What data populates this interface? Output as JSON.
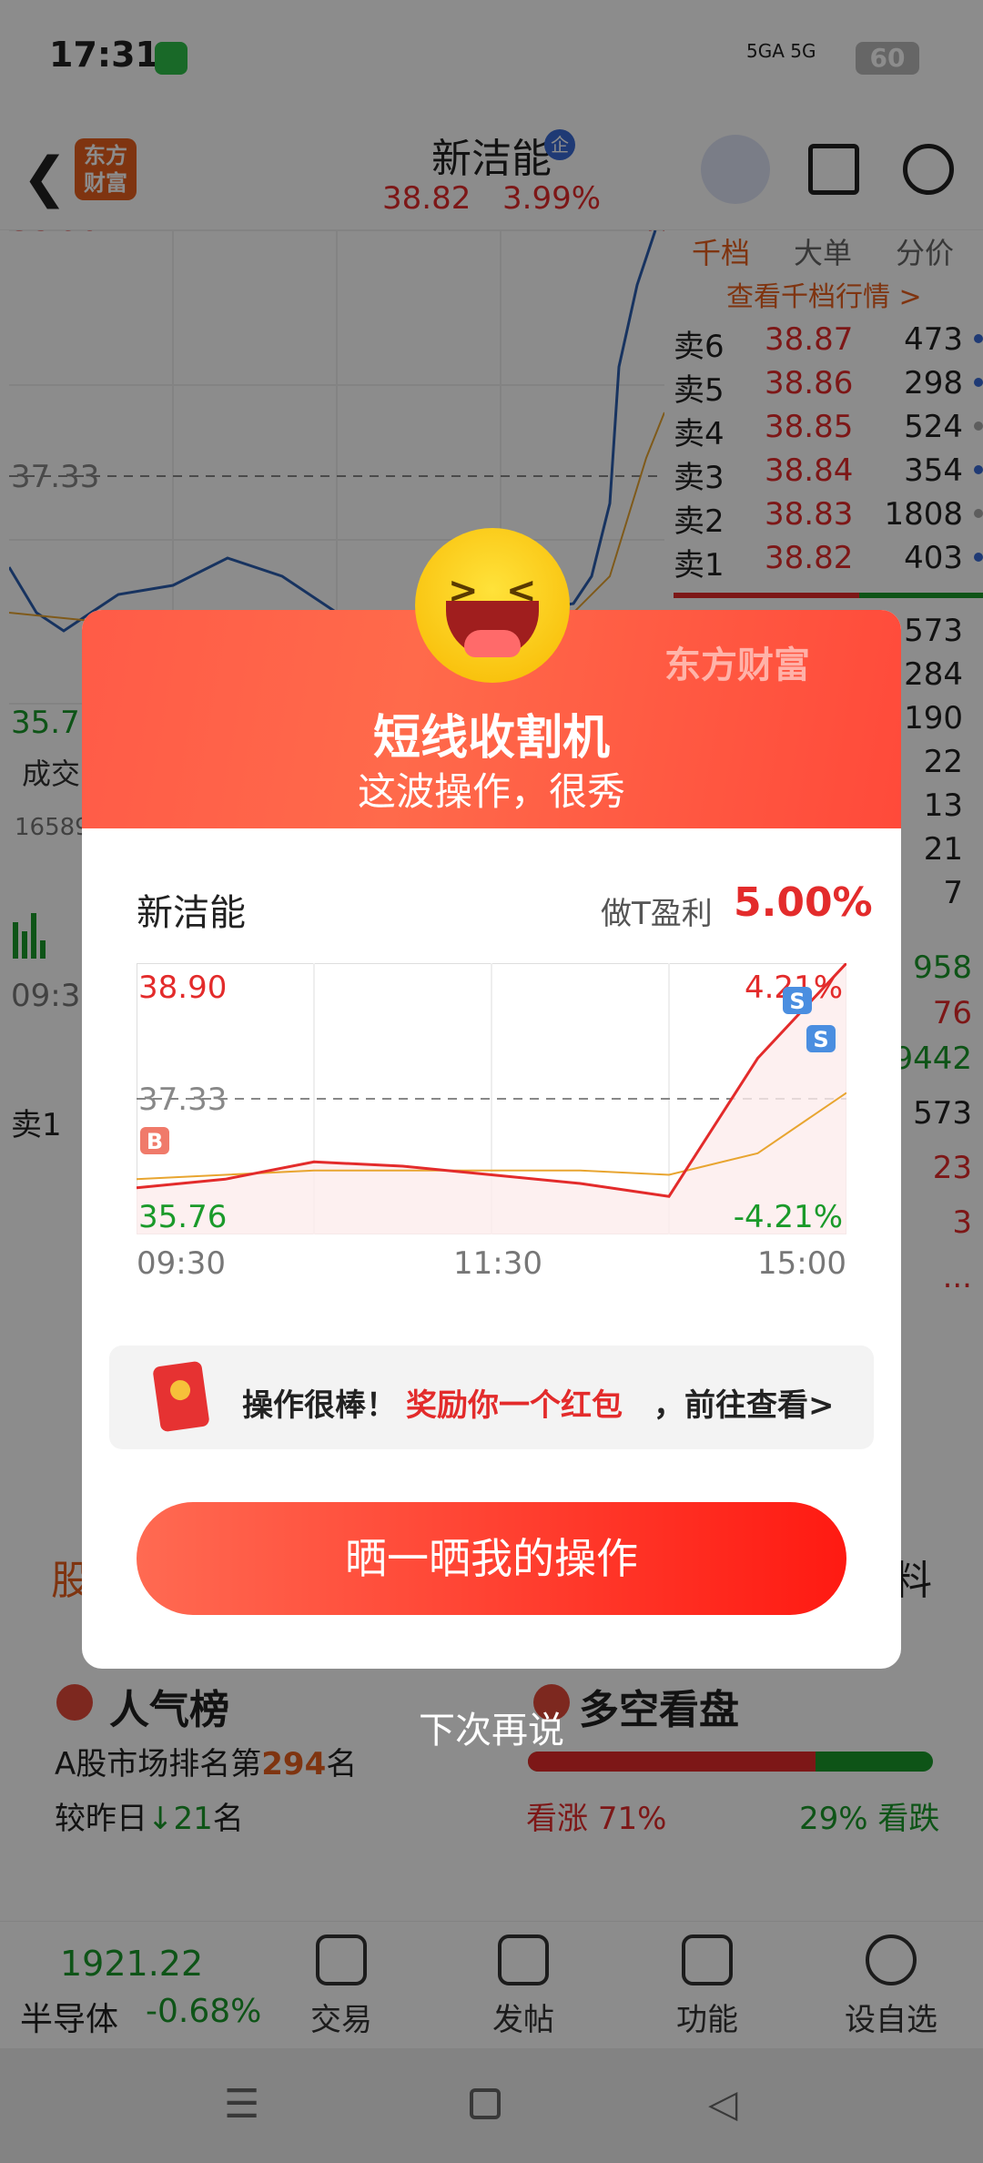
{
  "status_bar": {
    "time": "17:31",
    "signal_label": "5GA 5G",
    "battery": "60"
  },
  "header": {
    "logo_text": "东方财富",
    "stock_name": "新洁能",
    "badge": "企",
    "price": "38.82",
    "change_pct": "3.99%"
  },
  "background": {
    "chart_high": "38.90",
    "chart_ref": "37.33",
    "chart_low": "35.7",
    "chart_high_pct": "4.21%",
    "volume_label": "成交",
    "volume_value": "16589",
    "time_start": "09:30",
    "sell1_label": "卖1",
    "orderbook_tabs": [
      "千档",
      "大单",
      "分价"
    ],
    "orderbook_link": "查看千档行情 >",
    "orderbook_rows": [
      {
        "label": "卖6",
        "price": "38.87",
        "volume": "473"
      },
      {
        "label": "卖5",
        "price": "38.86",
        "volume": "298"
      },
      {
        "label": "卖4",
        "price": "38.85",
        "volume": "524"
      },
      {
        "label": "卖3",
        "price": "38.84",
        "volume": "354"
      },
      {
        "label": "卖2",
        "price": "38.83",
        "volume": "1808"
      },
      {
        "label": "卖1",
        "price": "38.82",
        "volume": "403"
      }
    ],
    "orderbook_more": [
      "573",
      "284",
      "190",
      "22",
      "13",
      "21",
      "7"
    ],
    "side_values": [
      "958",
      "76",
      "9442",
      "573",
      "23",
      "3",
      "..."
    ],
    "tabs_left": "股",
    "tabs_right": "料",
    "popularity": {
      "title": "人气榜",
      "rank_prefix": "A股市场排名第",
      "rank": "294",
      "rank_suffix": "名",
      "change_prefix": "较昨日",
      "change": "21",
      "change_suffix": "名"
    },
    "longshort": {
      "title": "多空看盘",
      "bull_label": "看涨",
      "bull_pct": "71%",
      "bear_pct": "29%",
      "bear_label": "看跌",
      "bull_fraction": 0.71
    },
    "nav": {
      "index_value": "1921.22",
      "index_name": "半导体",
      "index_change": "-0.68%",
      "items": [
        "交易",
        "发帖",
        "功能",
        "设自选"
      ]
    }
  },
  "modal": {
    "brand": "东方财富",
    "title": "短线收割机",
    "subtitle": "这波操作，很秀",
    "stock_name": "新洁能",
    "profit_label": "做T盈利",
    "profit_value": "5.00%",
    "chart": {
      "high": "38.90",
      "ref": "37.33",
      "low": "35.76",
      "high_pct": "4.21%",
      "low_pct": "-4.21%",
      "buy_marker": "B",
      "sell_marker": "S"
    },
    "time_ticks": [
      "09:30",
      "11:30",
      "15:00"
    ],
    "reward_text1": "操作很棒！",
    "reward_text2": "奖励你一个红包",
    "reward_text3": "，前往查看>",
    "share_button": "晒一晒我的操作",
    "later_button": "下次再说"
  },
  "chart_data": {
    "type": "line",
    "title": "",
    "x": [
      "09:30",
      "10:00",
      "10:30",
      "11:00",
      "11:30",
      "13:30",
      "14:00",
      "14:30",
      "15:00"
    ],
    "series": [
      {
        "values": [
          36.3,
          36.4,
          36.6,
          36.55,
          36.45,
          36.35,
          36.2,
          37.8,
          38.9
        ]
      },
      {
        "values": [
          36.4,
          36.45,
          36.5,
          36.5,
          36.5,
          36.5,
          36.45,
          36.7,
          37.4
        ]
      }
    ],
    "ylim": [
      35.76,
      38.9
    ],
    "reference_line": 37.33,
    "colors": {
      "price": "#e32b2b",
      "average": "#e8a530"
    },
    "markers": [
      "B",
      "S",
      "S"
    ]
  },
  "colors": {
    "accent": "#e32b2b",
    "up": "#e32b2b",
    "down": "#1a9a2a",
    "brand": "#e8601e"
  }
}
